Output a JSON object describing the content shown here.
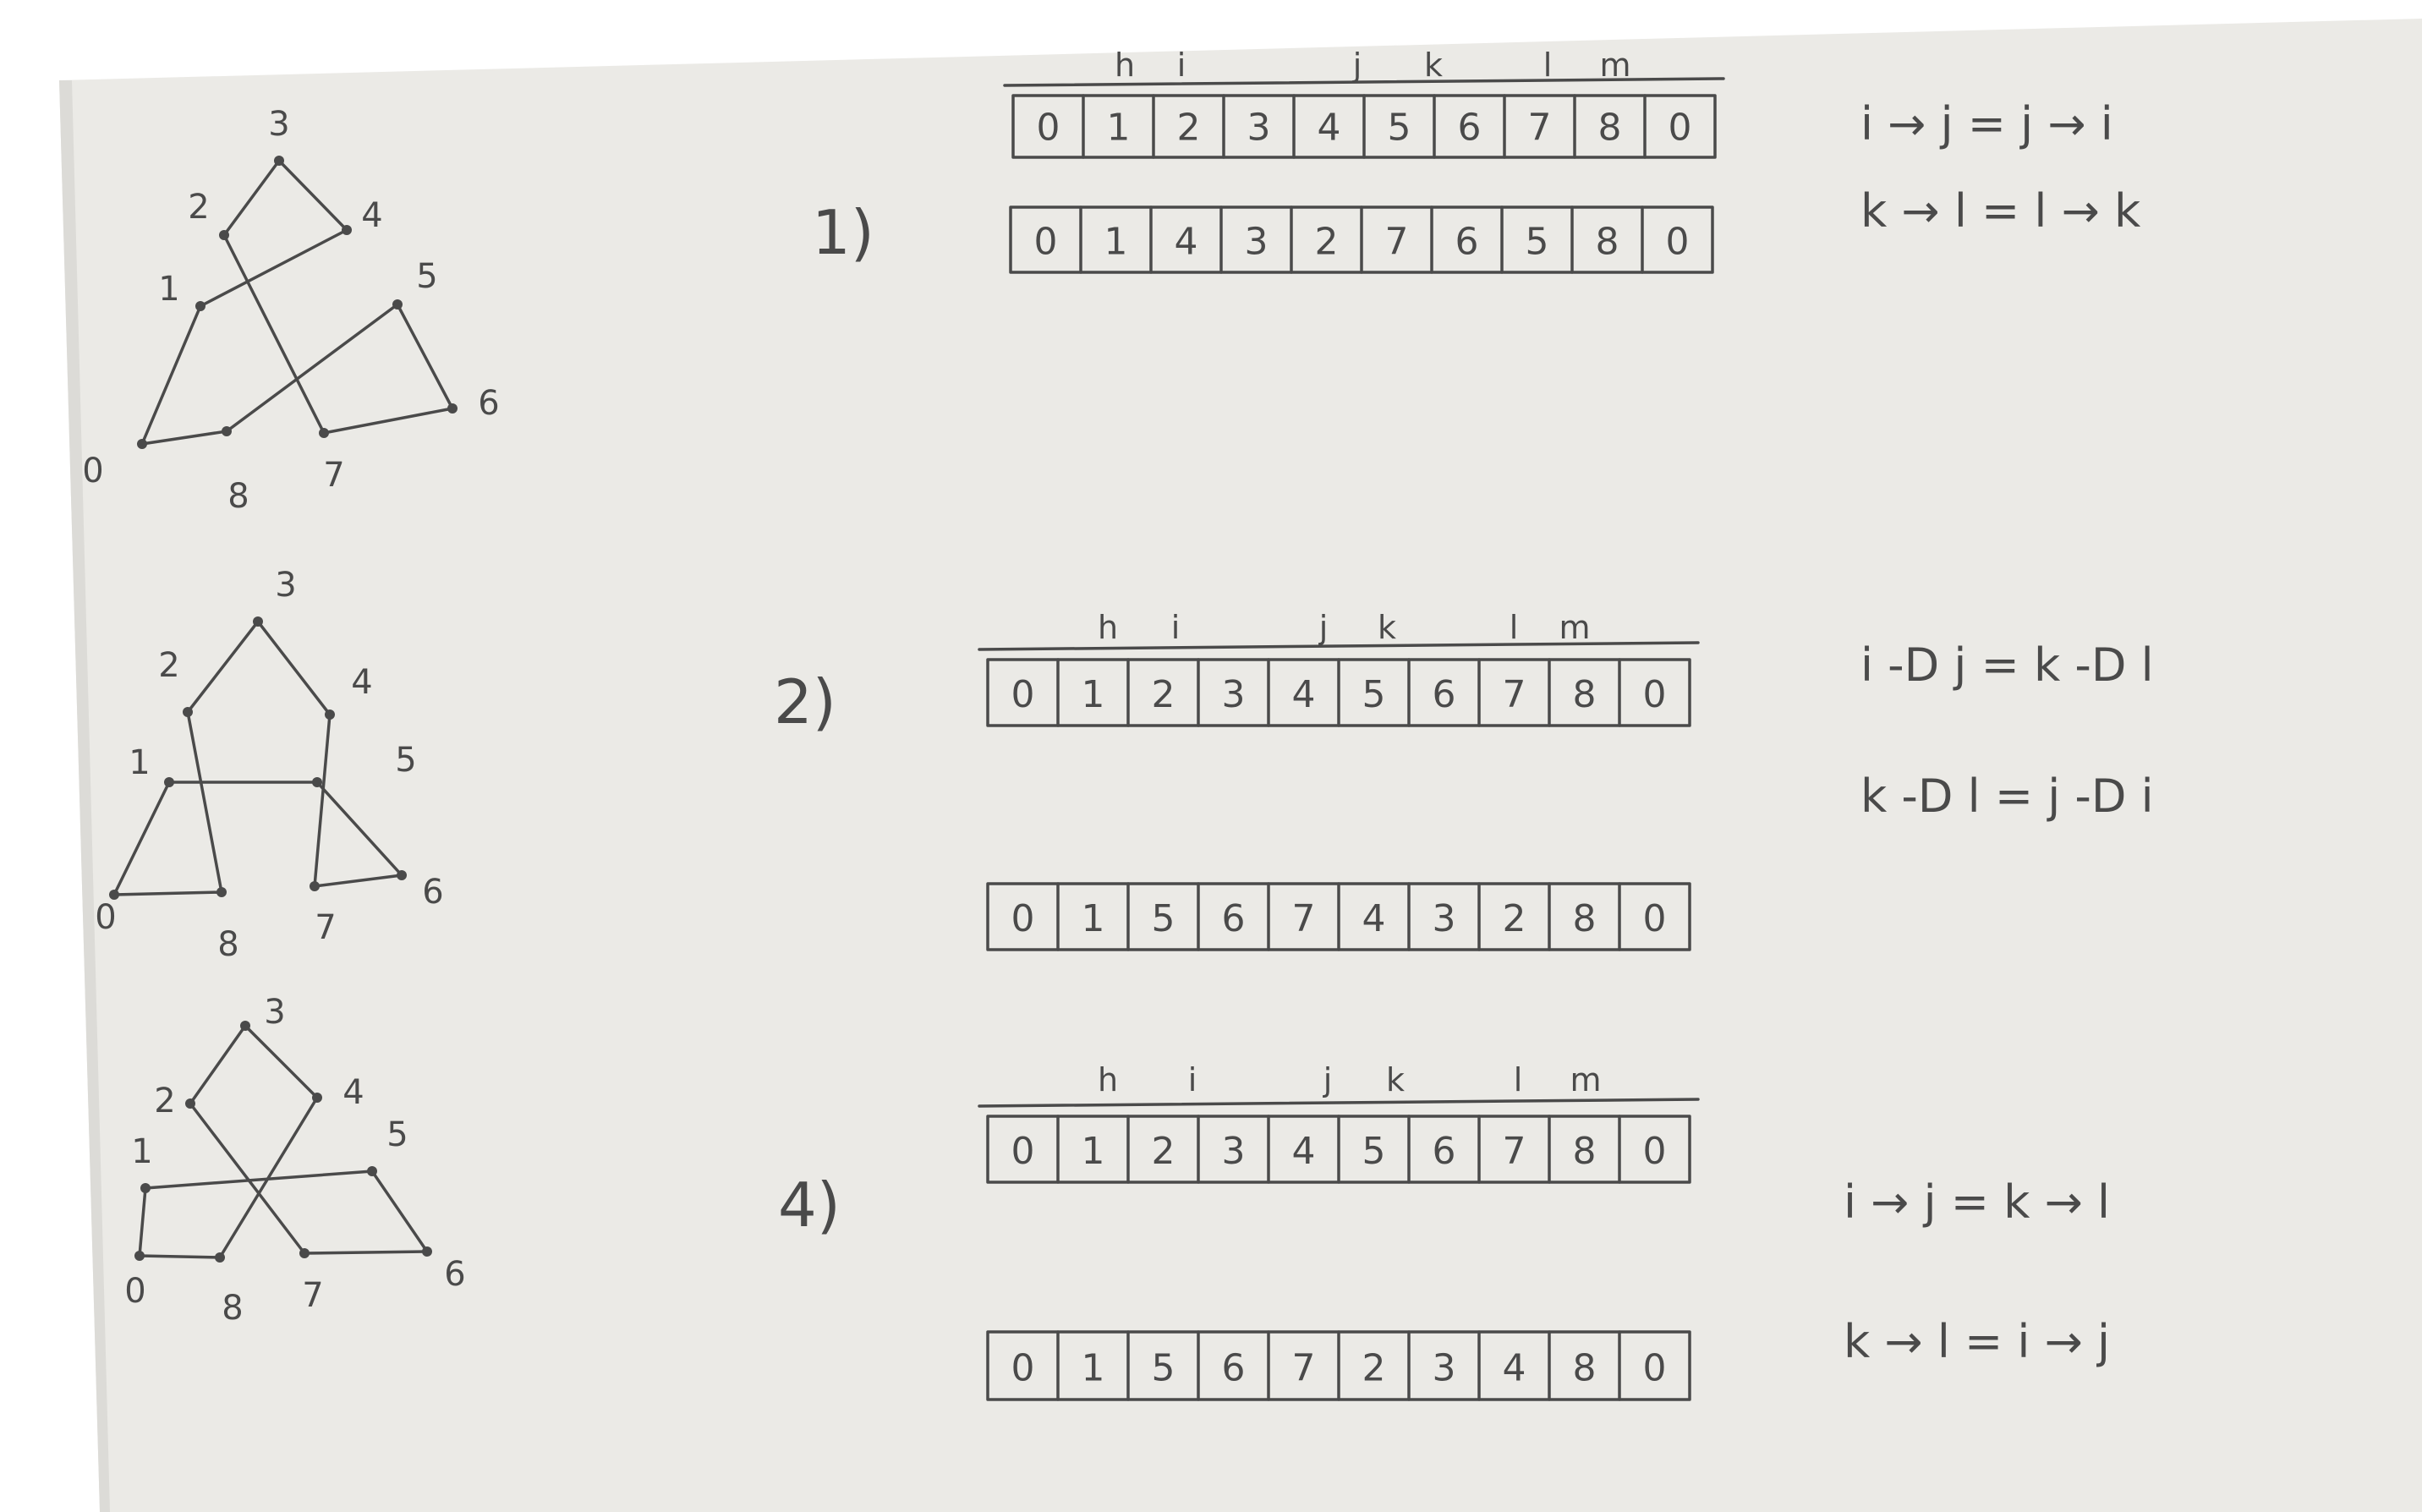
{
  "sections": [
    {
      "label": "1)",
      "figure": {
        "nodes": [
          {
            "id": "3",
            "label": "3"
          },
          {
            "id": "2",
            "label": "2"
          },
          {
            "id": "4",
            "label": "4"
          },
          {
            "id": "1",
            "label": "1"
          },
          {
            "id": "5",
            "label": "5"
          },
          {
            "id": "6",
            "label": "6"
          },
          {
            "id": "0",
            "label": "0"
          },
          {
            "id": "8",
            "label": "8"
          },
          {
            "id": "7",
            "label": "7"
          }
        ],
        "edges": [
          [
            "0",
            "1"
          ],
          [
            "1",
            "4"
          ],
          [
            "4",
            "3"
          ],
          [
            "3",
            "2"
          ],
          [
            "2",
            "7"
          ],
          [
            "7",
            "6"
          ],
          [
            "6",
            "5"
          ],
          [
            "5",
            "8"
          ],
          [
            "8",
            "0"
          ]
        ]
      },
      "arrays": [
        {
          "markers": [
            "h",
            "i",
            "j",
            "k",
            "l",
            "m"
          ],
          "cells": [
            "0",
            "1",
            "2",
            "3",
            "4",
            "5",
            "6",
            "7",
            "8",
            "0"
          ]
        },
        {
          "markers": [],
          "cells": [
            "0",
            "1",
            "4",
            "3",
            "2",
            "7",
            "6",
            "5",
            "8",
            "0"
          ]
        }
      ],
      "equations": [
        "i → j = j → i",
        "k → l = l → k"
      ]
    },
    {
      "label": "2)",
      "figure": {
        "nodes": [
          {
            "id": "3",
            "label": "3"
          },
          {
            "id": "2",
            "label": "2"
          },
          {
            "id": "4",
            "label": "4"
          },
          {
            "id": "1",
            "label": "1"
          },
          {
            "id": "5",
            "label": "5"
          },
          {
            "id": "6",
            "label": "6"
          },
          {
            "id": "0",
            "label": "0"
          },
          {
            "id": "8",
            "label": "8"
          },
          {
            "id": "7",
            "label": "7"
          }
        ],
        "edges": [
          [
            "0",
            "1"
          ],
          [
            "1",
            "5"
          ],
          [
            "5",
            "6"
          ],
          [
            "6",
            "7"
          ],
          [
            "7",
            "4"
          ],
          [
            "4",
            "3"
          ],
          [
            "3",
            "2"
          ],
          [
            "2",
            "8"
          ],
          [
            "8",
            "0"
          ]
        ]
      },
      "arrays": [
        {
          "markers": [
            "h",
            "i",
            "j",
            "k",
            "l",
            "m"
          ],
          "cells": [
            "0",
            "1",
            "2",
            "3",
            "4",
            "5",
            "6",
            "7",
            "8",
            "0"
          ]
        },
        {
          "markers": [],
          "cells": [
            "0",
            "1",
            "5",
            "6",
            "7",
            "4",
            "3",
            "2",
            "8",
            "0"
          ]
        }
      ],
      "equations": [
        "i -D j = k -D l",
        "k -D l = j -D i"
      ]
    },
    {
      "label": "4)",
      "figure": {
        "nodes": [
          {
            "id": "3",
            "label": "3"
          },
          {
            "id": "2",
            "label": "2"
          },
          {
            "id": "4",
            "label": "4"
          },
          {
            "id": "1",
            "label": "1"
          },
          {
            "id": "5",
            "label": "5"
          },
          {
            "id": "6",
            "label": "6"
          },
          {
            "id": "0",
            "label": "0"
          },
          {
            "id": "8",
            "label": "8"
          },
          {
            "id": "7",
            "label": "7"
          }
        ],
        "edges": [
          [
            "0",
            "1"
          ],
          [
            "1",
            "5"
          ],
          [
            "5",
            "6"
          ],
          [
            "6",
            "7"
          ],
          [
            "7",
            "2"
          ],
          [
            "2",
            "3"
          ],
          [
            "3",
            "4"
          ],
          [
            "4",
            "8"
          ],
          [
            "8",
            "0"
          ]
        ]
      },
      "arrays": [
        {
          "markers": [
            "h",
            "i",
            "j",
            "k",
            "l",
            "m"
          ],
          "cells": [
            "0",
            "1",
            "2",
            "3",
            "4",
            "5",
            "6",
            "7",
            "8",
            "0"
          ]
        },
        {
          "markers": [],
          "cells": [
            "0",
            "1",
            "5",
            "6",
            "7",
            "2",
            "3",
            "4",
            "8",
            "0"
          ]
        }
      ],
      "equations": [
        "i → j = k → l",
        "k → l = i → j"
      ]
    }
  ],
  "colors": {
    "paper": "#ebeae6",
    "ink": "#4a4a4a",
    "background": "#ffffff"
  }
}
